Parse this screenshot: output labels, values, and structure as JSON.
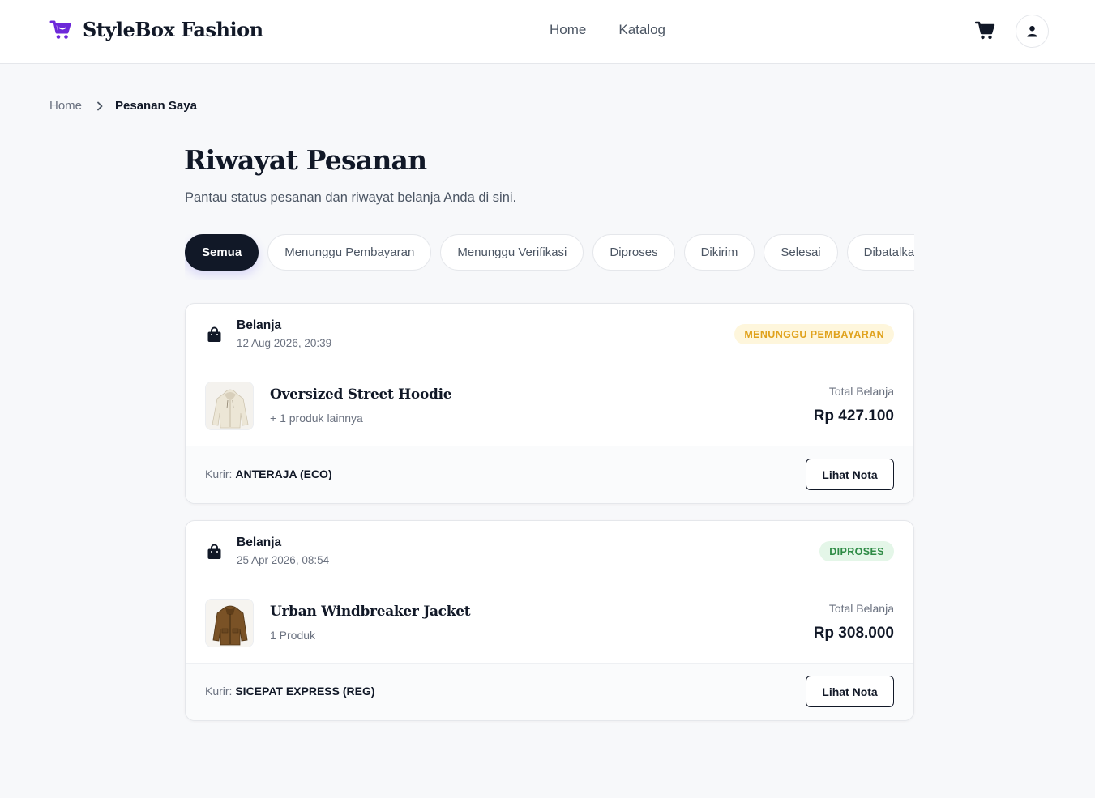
{
  "brand": {
    "name": "StyleBox Fashion",
    "accent": "#6d28d9"
  },
  "nav": {
    "items": [
      {
        "label": "Home"
      },
      {
        "label": "Katalog"
      }
    ]
  },
  "breadcrumb": {
    "home": "Home",
    "current": "Pesanan Saya"
  },
  "page": {
    "title": "Riwayat Pesanan",
    "subtitle": "Pantau status pesanan dan riwayat belanja Anda di sini."
  },
  "tabs": [
    {
      "label": "Semua",
      "active": true
    },
    {
      "label": "Menunggu Pembayaran",
      "active": false
    },
    {
      "label": "Menunggu Verifikasi",
      "active": false
    },
    {
      "label": "Diproses",
      "active": false
    },
    {
      "label": "Dikirim",
      "active": false
    },
    {
      "label": "Selesai",
      "active": false
    },
    {
      "label": "Dibatalkan",
      "active": false
    }
  ],
  "orders": [
    {
      "type": "Belanja",
      "date": "12 Aug 2026, 20:39",
      "status": "MENUNGGU PEMBAYARAN",
      "status_color": "#e0a21d",
      "product_name": "Oversized Street Hoodie",
      "product_more": "+ 1 produk lainnya",
      "thumb_icon": "hoodie-image",
      "total_label": "Total Belanja",
      "total_value": "Rp 427.100",
      "courier_label": "Kurir:",
      "courier_value": "ANTERAJA (ECO)",
      "button_label": "Lihat Nota"
    },
    {
      "type": "Belanja",
      "date": "25 Apr 2026, 08:54",
      "status": "DIPROSES",
      "status_color": "#2e8b45",
      "product_name": "Urban Windbreaker Jacket",
      "product_more": "1 Produk",
      "thumb_icon": "jacket-image",
      "total_label": "Total Belanja",
      "total_value": "Rp 308.000",
      "courier_label": "Kurir:",
      "courier_value": "SICEPAT EXPRESS (REG)",
      "button_label": "Lihat Nota"
    }
  ]
}
